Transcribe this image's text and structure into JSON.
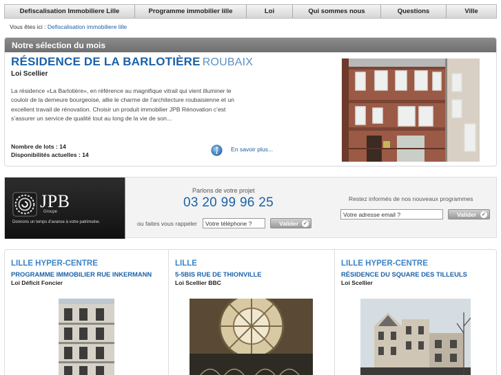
{
  "nav": {
    "items": [
      {
        "label": "Defiscalisation Immobiliere Lille"
      },
      {
        "label": "Programme immobilier lille"
      },
      {
        "label": "Loi"
      },
      {
        "label": "Qui sommes nous"
      },
      {
        "label": "Questions"
      },
      {
        "label": "Ville"
      }
    ]
  },
  "breadcrumb": {
    "prefix": "Vous êtes ici :",
    "current": "Defiscalisation immobiliere lille"
  },
  "selection": {
    "header": "Notre sélection du mois",
    "title": "RÉSIDENCE DE LA BARLOTIÈRE",
    "city": "ROUBAIX",
    "law": "Loi Scellier",
    "description": "La résidence «La Barlotière», en référence au magnifique vitrail qui vient illuminer le couloir de la demeure bourgeoise, allie le charme de l’architecture roubaisienne et un excellent travail de rénovation. Choisir un produit immobilier JPB Rénovation c’est s’assurer un service de qualité tout au long de la vie de son...",
    "lots": "Nombre de lots : 14",
    "availability": "Disponibilités actuelles : 14",
    "more_link": "En savoir plus..."
  },
  "contact": {
    "logo_text": "JPB",
    "logo_sub": "Groupe",
    "logo_tagline": "Donnons un temps d'avance à votre patrimoine.",
    "talk_label": "Parlons de votre projet",
    "phone": "03 20 99 96 25",
    "callback_label": "ou faites vous rappeler",
    "phone_placeholder": "Votre téléphone ?",
    "validate_label": "Valider",
    "news_label": "Restez informés de nos nouveaux programmes",
    "email_placeholder": "Votre adresse email ?"
  },
  "programs": [
    {
      "city": "LILLE HYPER-CENTRE",
      "name": "PROGRAMME IMMOBILIER RUE INKERMANN",
      "law": "Loi Déficit Foncier"
    },
    {
      "city": "LILLE",
      "name": "5-5BIS RUE DE THIONVILLE",
      "law": "Loi Scellier BBC"
    },
    {
      "city": "LILLE HYPER-CENTRE",
      "name": "RÉSIDENCE DU SQUARE DES TILLEULS",
      "law": "Loi Scellier"
    }
  ],
  "colors": {
    "accent_blue": "#1a61a8",
    "light_blue": "#3c83c7",
    "header_gray": "#7a7a7a"
  },
  "icons": [
    "info-icon",
    "check-icon",
    "jpb-swirl-logo"
  ]
}
